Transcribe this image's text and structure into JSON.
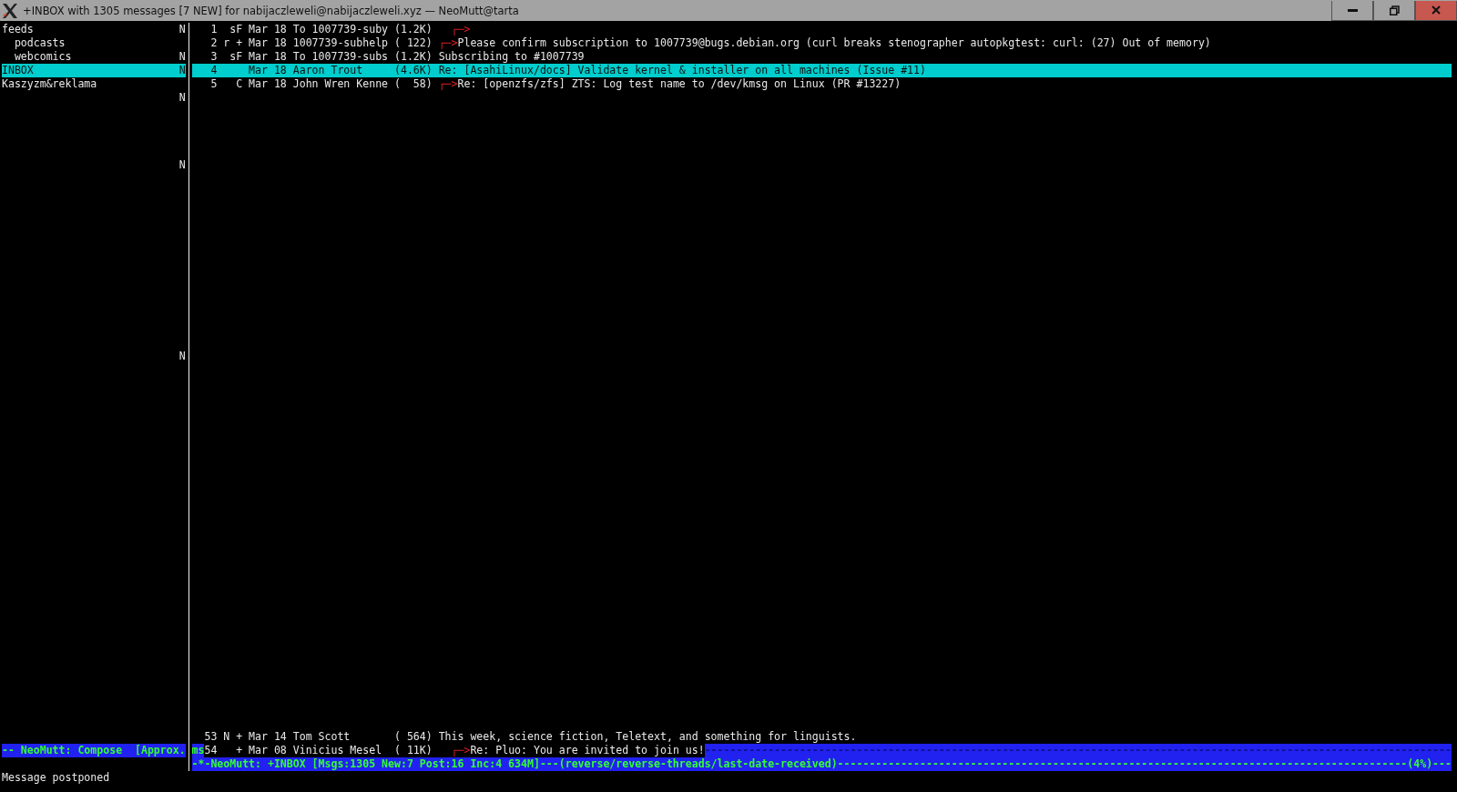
{
  "window": {
    "title": "+INBOX with 1305 messages [7 NEW] for nabijaczleweli@nabijaczleweli.xyz — NeoMutt@tarta"
  },
  "sidebar": {
    "mailboxes": [
      {
        "name": "feeds",
        "new_flag": "N",
        "selected": false,
        "children": [
          {
            "name": "podcasts",
            "selected": false
          },
          {
            "name": "webcomics",
            "new_flag": "N",
            "selected": false
          }
        ]
      },
      {
        "name": "INBOX",
        "new_flag": "N",
        "selected": true
      },
      {
        "name": "Kaszyzm&reklama",
        "selected": false
      }
    ],
    "stray_flags": [
      "N",
      "N",
      "N"
    ],
    "compose_status": "-- NeoMutt: Compose  [Approx."
  },
  "index": {
    "messages": [
      {
        "line": "   1  sF Mar 18 To 1007739-suby (1.2K) ",
        "thread": "  ┌─>",
        "selected": false
      },
      {
        "line": "   2 r + Mar 18 1007739-subhelp ( 122) ",
        "thread": "┌─>",
        "subject": "Please confirm subscription to 1007739@bugs.debian.org (curl breaks stenographer autopkgtest: curl: (27) Out of memory)",
        "selected": false
      },
      {
        "line": "   3  sF Mar 18 To 1007739-subs (1.2K) ",
        "subject": "Subscribing to #1007739",
        "selected": false
      },
      {
        "line": "   4     Mar 18 Aaron Trout     (4.6K) ",
        "subject": "Re: [AsahiLinux/docs] Validate kernel & installer on all machines (Issue #11)",
        "selected": true
      },
      {
        "line": "   5   C Mar 18 John Wren Kenne (  58) ",
        "thread": "┌─>",
        "subject": "Re: [openzfs/zfs] ZTS: Log test name to /dev/kmsg on Linux (PR #13227)",
        "selected": false
      }
    ],
    "bottom_messages": [
      {
        "line": "  53 N + Mar 14 Tom Scott       ( 564) ",
        "subject": "This week, science fiction, Teletext, and something for linguists.",
        "selected": false
      }
    ],
    "stale_line": {
      "fragment": "ms",
      "message": {
        "line": "54   + Mar 08 Vinicius Mesel  ( 11K) ",
        "thread": "  ┌─>",
        "subject": "Re: Pluo: You are invited to join us!",
        "selected": false
      },
      "filler": "----------------------------------------------------------------------------------------------------------------------"
    }
  },
  "status_bar": "-*-NeoMutt: +INBOX [Msgs:1305 New:7 Post:16 Inc:4 634M]---(reverse/reverse-threads/last-date-received)------------------------------------------------------------------------------------------(4%)---",
  "message_line": "Message postponed"
}
